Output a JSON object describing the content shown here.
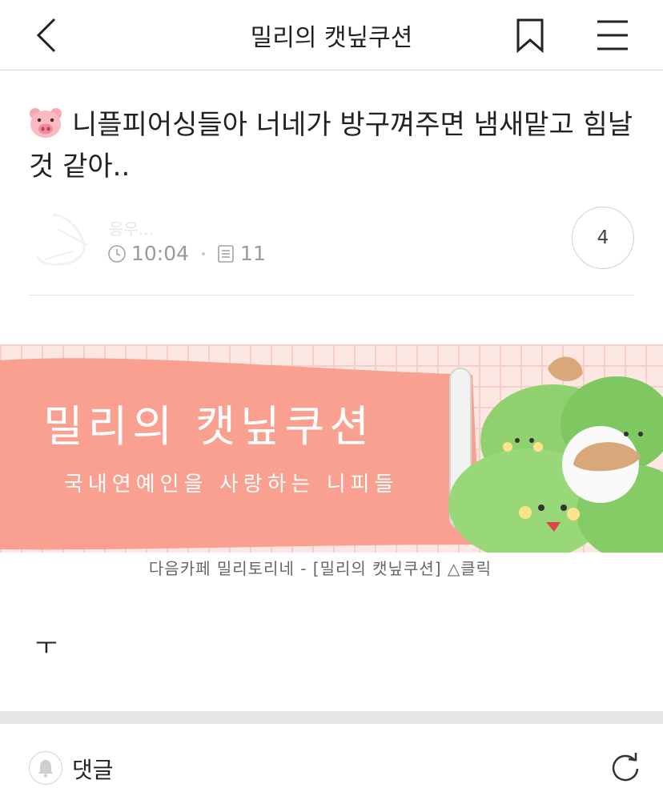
{
  "header": {
    "title": "밀리의 캣닢쿠션",
    "back_icon": "chevron-left-icon",
    "bookmark_icon": "bookmark-icon",
    "menu_icon": "hamburger-menu-icon"
  },
  "post": {
    "emoji_icon": "pig-face-icon",
    "title": "니플피어싱들아 너네가 방구껴주면 냄새맡고 힘날 것 같아..",
    "author": "응우...",
    "time": "10:04",
    "views": "11",
    "comment_count": "4"
  },
  "banner": {
    "title": "밀리의 캣닢쿠션",
    "subtitle": "국내연예인을 사랑하는 니피들",
    "caption": "다음카페 밀리토리네 - [밀리의 캣닢쿠션] △클릭",
    "colors": {
      "ribbon": "#f9a091",
      "grid_bg": "#fde7e3",
      "cabbage": "#8ccf6e"
    }
  },
  "body": {
    "text": "ㅜ"
  },
  "footer": {
    "comment_label": "댓글",
    "bell_icon": "bell-icon",
    "refresh_icon": "refresh-icon"
  }
}
